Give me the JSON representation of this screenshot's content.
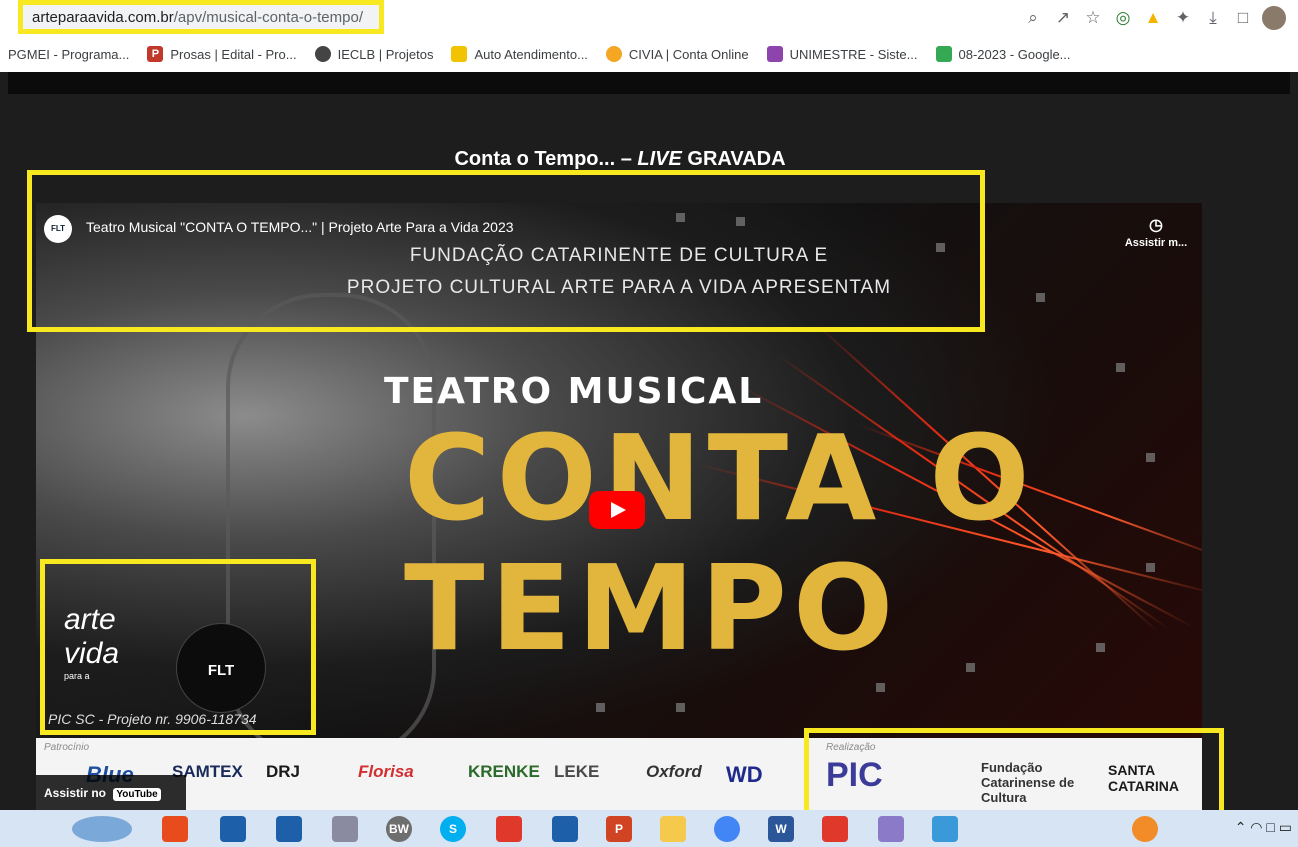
{
  "browser": {
    "url_domain": "arteparaavida.com.br",
    "url_path": "/apv/musical-conta-o-tempo/",
    "bookmarks": [
      {
        "label": "PGMEI - Programa...",
        "color": "#d9d9d9"
      },
      {
        "label": "Prosas | Edital - Pro...",
        "color": "#c0392b"
      },
      {
        "label": "IECLB | Projetos",
        "color": "#444444"
      },
      {
        "label": "Auto Atendimento...",
        "color": "#f2c300"
      },
      {
        "label": "CIVIA | Conta Online",
        "color": "#f5a623"
      },
      {
        "label": "UNIMESTRE - Siste...",
        "color": "#8e44ad"
      },
      {
        "label": "08-2023 - Google...",
        "color": "#34a853"
      }
    ]
  },
  "page": {
    "heading_pre": "Conta o Tempo... – ",
    "heading_live": "LIVE",
    "heading_post": " GRAVADA"
  },
  "video": {
    "channel_badge": "FLT",
    "title": "Teatro Musical \"CONTA O TEMPO...\" | Projeto Arte Para a Vida 2023",
    "watch_later": "Assistir m...",
    "present_line1": "FUNDAÇÃO CATARINENTE DE CULTURA E",
    "present_line2": "PROJETO CULTURAL ARTE PARA A VIDA APRESENTAM",
    "teatro": "TEATRO MUSICAL",
    "conta": "CONTA O",
    "tempo": "TEMPO",
    "logo_arte": "arte vida",
    "logo_arte_sub": "para a",
    "logo_flt": "FLT",
    "pic_line": "PIC SC - Projeto nr. 9906-118734",
    "sponsor_label": "Patrocínio",
    "realization_label": "Realização",
    "sponsors": [
      "Blue",
      "SAMTEX",
      "DRJ",
      "Florisa",
      "KRENKE",
      "LEKE",
      "Oxford",
      "WD"
    ],
    "realizers": [
      "PIC",
      "Fundação Catarinense de Cultura",
      "SANTA CATARINA"
    ],
    "watch_on": "Assistir no",
    "youtube": "YouTube"
  },
  "taskbar": {
    "apps": [
      "start",
      "bw",
      "skype",
      "word",
      "acrobat",
      "chrome"
    ]
  }
}
